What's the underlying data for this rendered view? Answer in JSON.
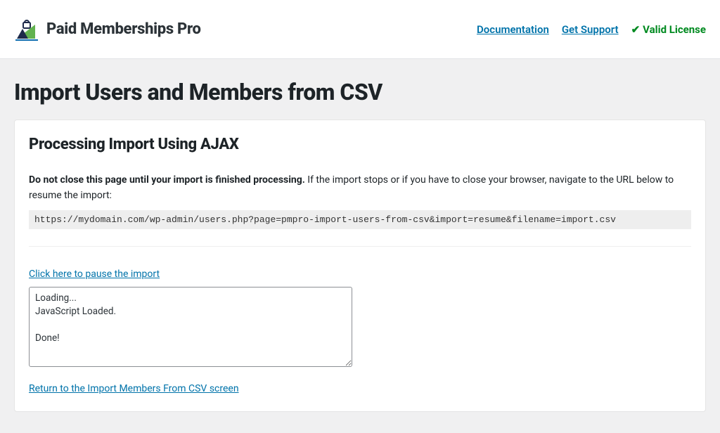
{
  "header": {
    "brand_name": "Paid Memberships Pro",
    "links": {
      "documentation": "Documentation",
      "support": "Get Support",
      "license_label": "Valid License"
    }
  },
  "page": {
    "title": "Import Users and Members from CSV"
  },
  "panel": {
    "heading": "Processing Import Using AJAX",
    "warning_strong": "Do not close this page until your import is finished processing.",
    "warning_rest": " If the import stops or if you have to close your browser, navigate to the URL below to resume the import:",
    "resume_url": "https://mydomain.com/wp-admin/users.php?page=pmpro-import-users-from-csv&import=resume&filename=import.csv",
    "pause_link": "Click here to pause the import",
    "log_text": "Loading...\nJavaScript Loaded.\n\nDone!",
    "return_link": "Return to the Import Members From CSV screen"
  }
}
